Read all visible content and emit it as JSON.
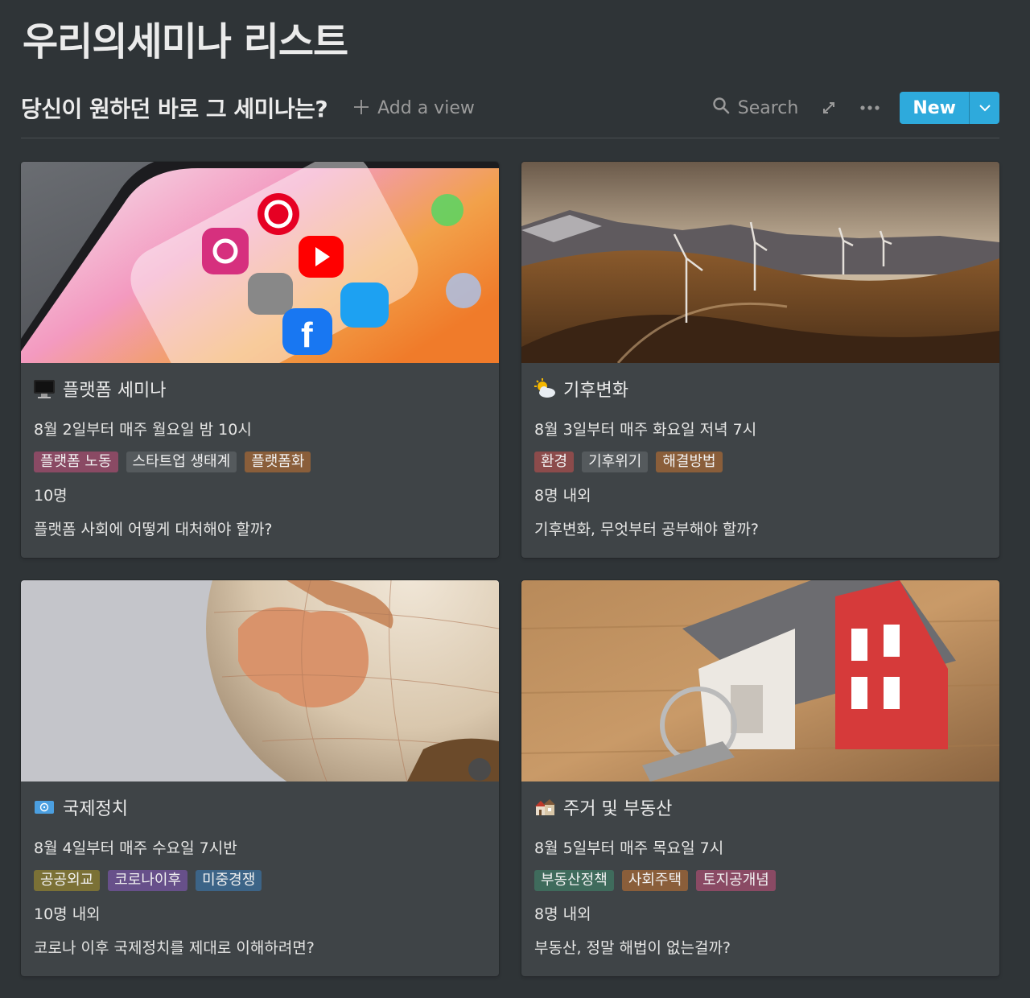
{
  "page": {
    "title": "우리의세미나 리스트"
  },
  "view": {
    "title": "당신이 원하던 바로 그 세미나는?",
    "add_view_label": "Add a view",
    "search_label": "Search",
    "new_label": "New"
  },
  "colors": {
    "background": "#2f3437",
    "card": "#3f4447",
    "accent": "#2eaadc"
  },
  "cards": [
    {
      "emoji": "desktop-computer-icon",
      "title": "플랫폼 세미나",
      "schedule": "8월 2일부터 매주 월요일 밤 10시",
      "tags": [
        {
          "label": "플랫폼 노동",
          "color": "#8a4a64"
        },
        {
          "label": "스타트업 생태계",
          "color": "#555a5d"
        },
        {
          "label": "플랫폼화",
          "color": "#8a5e3a"
        }
      ],
      "count": "10명",
      "question": "플랫폼 사회에 어떻게 대처해야 할까?"
    },
    {
      "emoji": "sun-behind-cloud-icon",
      "title": "기후변화",
      "schedule": "8월 3일부터 매주 화요일 저녁 7시",
      "tags": [
        {
          "label": "환경",
          "color": "#8c4b4b"
        },
        {
          "label": "기후위기",
          "color": "#555a5d"
        },
        {
          "label": "해결방법",
          "color": "#8a5e3a"
        }
      ],
      "count": "8명 내외",
      "question": "기후변화, 무엇부터 공부해야 할까?"
    },
    {
      "emoji": "united-nations-flag-icon",
      "title": "국제정치",
      "schedule": "8월 4일부터 매주 수요일 7시반",
      "tags": [
        {
          "label": "공공외교",
          "color": "#7b7136"
        },
        {
          "label": "코로나이후",
          "color": "#67508a"
        },
        {
          "label": "미중경쟁",
          "color": "#3c6487"
        }
      ],
      "count": "10명 내외",
      "question": "코로나 이후 국제정치를 제대로 이해하려면?"
    },
    {
      "emoji": "houses-icon",
      "title": "주거 및 부동산",
      "schedule": "8월 5일부터 매주 목요일 7시",
      "tags": [
        {
          "label": "부동산정책",
          "color": "#3f6b5c"
        },
        {
          "label": "사회주택",
          "color": "#8a5e3a"
        },
        {
          "label": "토지공개념",
          "color": "#8a4a64"
        }
      ],
      "count": "8명 내외",
      "question": "부동산, 정말 해법이 없는걸까?"
    }
  ]
}
